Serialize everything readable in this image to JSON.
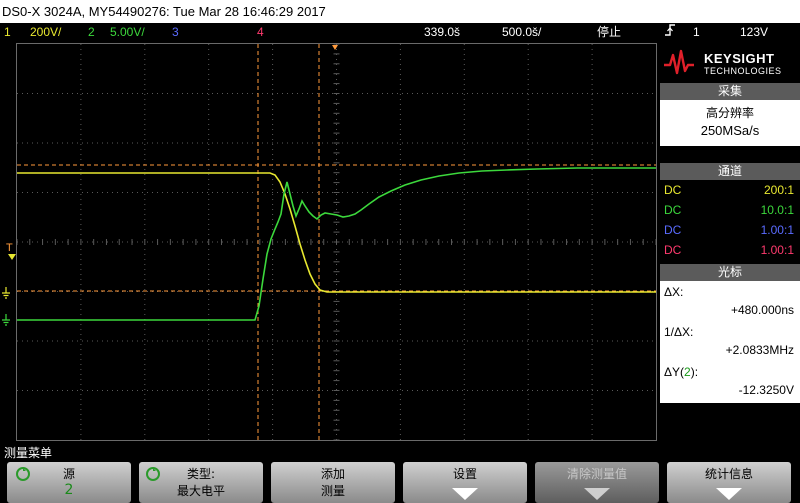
{
  "title": "DS0-X 3024A, MY54490276: Tue Mar 28 16:46:29 2017",
  "status": {
    "ch1_num": "1",
    "ch1_scale": "200V/",
    "ch2_num": "2",
    "ch2_scale": "5.00V/",
    "ch3_num": "3",
    "ch4_num": "4",
    "timebase_delay": "339.0š",
    "timebase_scale": "500.0š/",
    "run_state": "停止",
    "trigger_icon": "trigger-rising-edge-icon",
    "trigger_source": "1",
    "trigger_level": "123V"
  },
  "markers": {
    "trig": "T",
    "ch1": "1",
    "ch2": "2"
  },
  "brand": {
    "name": "KEYSIGHT",
    "sub": "TECHNOLOGIES"
  },
  "acquisition": {
    "header": "采集",
    "mode": "高分辨率",
    "rate": "250MSa/s"
  },
  "channels": {
    "header": "通道",
    "rows": [
      {
        "coupling": "DC",
        "ratio": "200:1",
        "color": "#e8e830"
      },
      {
        "coupling": "DC",
        "ratio": "10.0:1",
        "color": "#3cd83c"
      },
      {
        "coupling": "DC",
        "ratio": "1.00:1",
        "color": "#5a6bff"
      },
      {
        "coupling": "DC",
        "ratio": "1.00:1",
        "color": "#ff3a6e"
      }
    ]
  },
  "cursors": {
    "header": "光标",
    "dx_label": "ΔX:",
    "dx_value": "+480.000ns",
    "inv_label": "1/ΔX:",
    "inv_value": "+2.0833MHz",
    "dy_label_a": "ΔY(",
    "dy_label_ch": "2",
    "dy_label_b": "):",
    "dy_value": "-12.3250V"
  },
  "menu": {
    "title": "测量菜单",
    "keys": [
      {
        "l1": "源",
        "l2": "2"
      },
      {
        "l1": "类型:",
        "l2": "最大电平"
      },
      {
        "l1": "添加",
        "l2": "测量"
      },
      {
        "l1": "设置",
        "l2": ""
      },
      {
        "l1": "清除测量值",
        "l2": ""
      },
      {
        "l1": "统计信息",
        "l2": ""
      }
    ]
  },
  "colors": {
    "ch1": "#e8e830",
    "ch2": "#3cd83c",
    "ch3": "#5a6bff",
    "ch4": "#ff3a6e",
    "cursor": "#ff9a3c",
    "grid": "#5a5a5a"
  }
}
